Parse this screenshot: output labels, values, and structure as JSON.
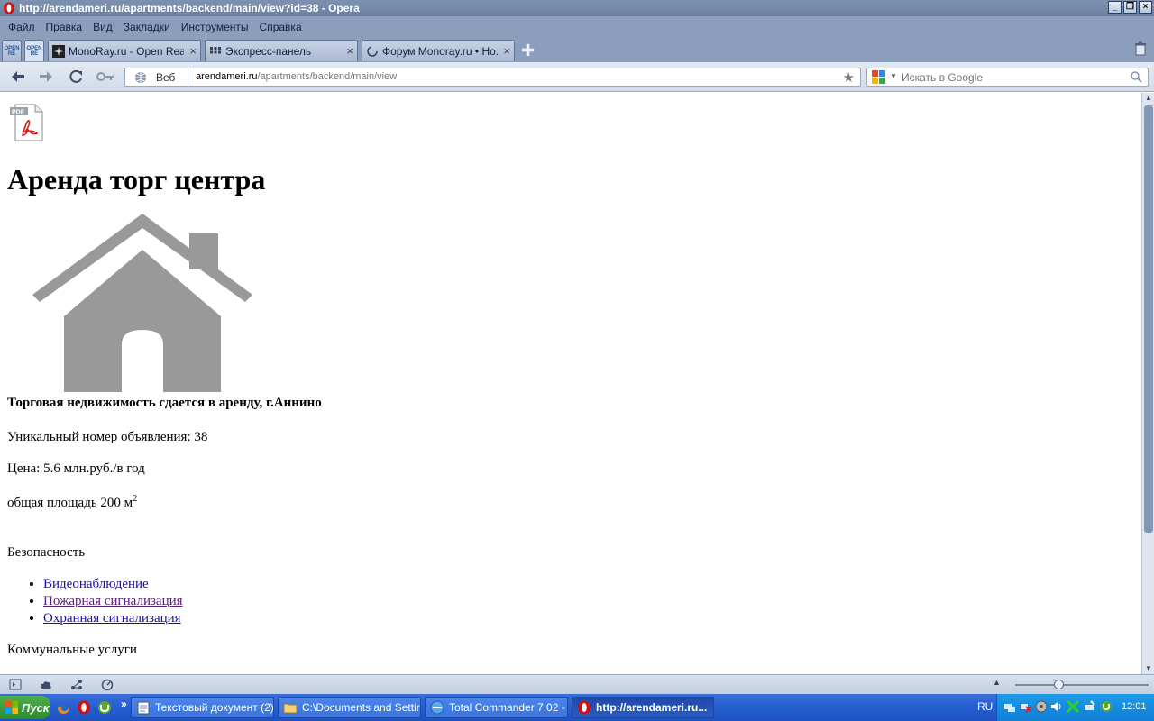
{
  "window": {
    "title": "http://arendameri.ru/apartments/backend/main/view?id=38 - Opera",
    "controls": [
      "_",
      "❐",
      "×"
    ]
  },
  "menu": [
    "Файл",
    "Правка",
    "Вид",
    "Закладки",
    "Инструменты",
    "Справка"
  ],
  "tabs": {
    "pinned": [
      {
        "label": "OPEN RE"
      },
      {
        "label": "OPEN RE"
      }
    ],
    "items": [
      {
        "label": "MonoRay.ru - Open Real ...",
        "close": "×"
      },
      {
        "label": "Экспресс-панель",
        "close": "×"
      },
      {
        "label": "Форум Monoray.ru • Но...",
        "close": "×"
      }
    ],
    "new_tab": "✚"
  },
  "address": {
    "web_label": "Веб",
    "url_host": "arendameri.ru",
    "url_path": "/apartments/backend/main/view",
    "star": "★"
  },
  "search": {
    "placeholder": "Искать в Google"
  },
  "page": {
    "title": "Аренда торг центра",
    "subtitle": "Торговая недвижимость сдается в аренду, г.Аннино",
    "unique_id": "Уникальный номер объявления: 38",
    "price": "Цена: 5.6 млн.руб./в год",
    "area": "общая площадь 200 м",
    "area_sup": "2",
    "security_heading": "Безопасность",
    "security_items": [
      "Видеонаблюдение",
      "Пожарная сигнализация",
      "Охранная сигнализация"
    ],
    "utilities_heading": "Коммунальные услуги"
  },
  "scrollbar": {
    "up": "▲",
    "down": "▼"
  },
  "statusbar": {
    "zoom_up": "▲",
    "zoom_percent": 33
  },
  "taskbar": {
    "start": "Пуск",
    "ql_more": "»",
    "tasks": [
      "Текстовый документ (2)...",
      "C:\\Documents and Settin...",
      "Total Commander 7.02 - Z...",
      "http://arendameri.ru..."
    ],
    "lang": "RU",
    "clock": "12:01"
  },
  "colors": {
    "link": "#1a0dab",
    "link_visited": "#5a1a7a",
    "house_icon": "#999999"
  }
}
